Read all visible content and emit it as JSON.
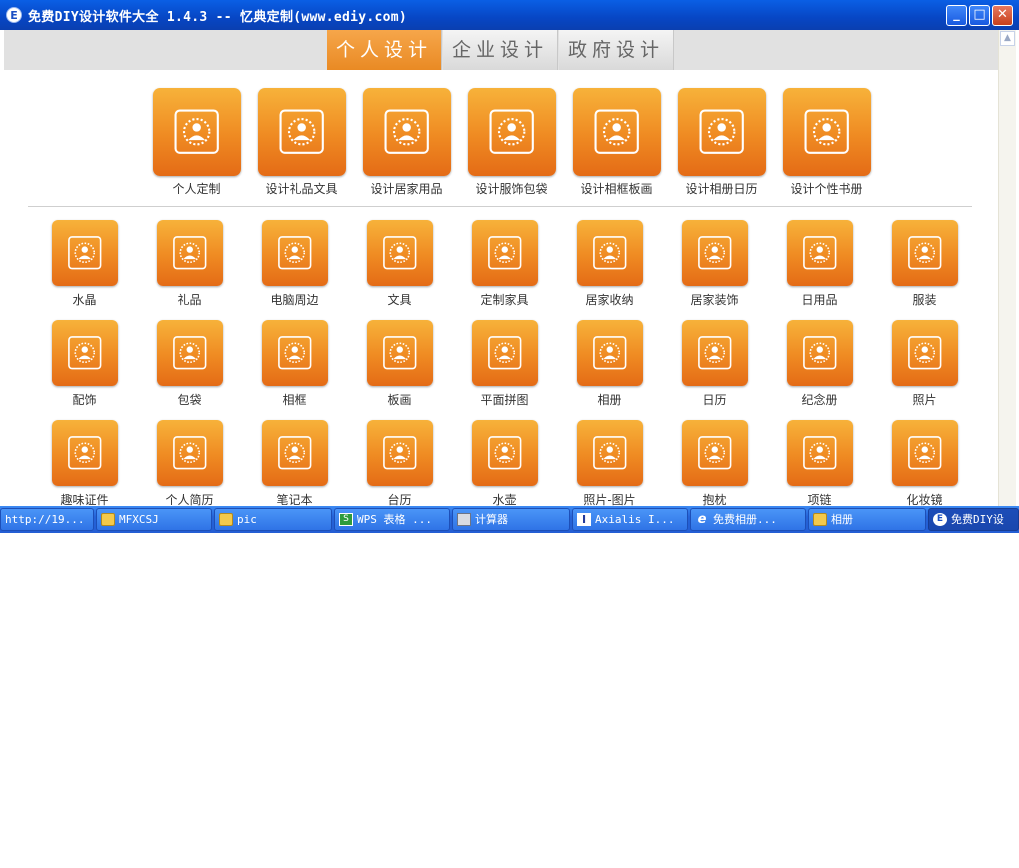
{
  "window": {
    "app_icon": "E",
    "title": "免费DIY设计软件大全 1.4.3 -- 忆典定制(www.ediy.com)",
    "buttons": {
      "minimize": "_",
      "maximize": "□",
      "close": "✕"
    }
  },
  "tabs": [
    {
      "label": "个人设计",
      "active": true
    },
    {
      "label": "企业设计",
      "active": false
    },
    {
      "label": "政府设计",
      "active": false
    }
  ],
  "scrollbar": {
    "up_arrow": "▲"
  },
  "featured": [
    {
      "label": "个人定制",
      "icon": "personal-custom-icon"
    },
    {
      "label": "设计礼品文具",
      "icon": "mug-icon"
    },
    {
      "label": "设计居家用品",
      "icon": "storage-box-icon"
    },
    {
      "label": "设计服饰包袋",
      "icon": "apparel-bag-icon"
    },
    {
      "label": "设计相框板画",
      "icon": "photo-frame-icon"
    },
    {
      "label": "设计相册日历",
      "icon": "calendar-icon"
    },
    {
      "label": "设计个性书册",
      "icon": "books-icon"
    }
  ],
  "categories": [
    {
      "label": "水晶",
      "icon": "crystal-icon"
    },
    {
      "label": "礼品",
      "icon": "keychain-icon"
    },
    {
      "label": "电脑周边",
      "icon": "laptop-table-icon"
    },
    {
      "label": "文具",
      "icon": "pencil-case-icon"
    },
    {
      "label": "定制家具",
      "icon": "stool-icon"
    },
    {
      "label": "居家收纳",
      "icon": "trash-bin-icon"
    },
    {
      "label": "居家装饰",
      "icon": "wall-clock-icon"
    },
    {
      "label": "日用品",
      "icon": "cups-icon"
    },
    {
      "label": "服装",
      "icon": "tshirt-icon"
    },
    {
      "label": "配饰",
      "icon": "cap-icon"
    },
    {
      "label": "包袋",
      "icon": "backpack-icon"
    },
    {
      "label": "相框",
      "icon": "frame-stand-icon"
    },
    {
      "label": "板画",
      "icon": "round-mirror-icon"
    },
    {
      "label": "平面拼图",
      "icon": "puzzle-icon"
    },
    {
      "label": "相册",
      "icon": "photo-album-icon"
    },
    {
      "label": "日历",
      "icon": "desk-calendar-icon"
    },
    {
      "label": "纪念册",
      "icon": "memorial-book-icon"
    },
    {
      "label": "照片",
      "icon": "photo-print-icon"
    },
    {
      "label": "趣味证件",
      "icon": "certificate-icon"
    },
    {
      "label": "个人简历",
      "icon": "resume-icon"
    },
    {
      "label": "笔记本",
      "icon": "notebook-icon"
    },
    {
      "label": "台历",
      "icon": "table-calendar-icon"
    },
    {
      "label": "水壶",
      "icon": "bottle-icon"
    },
    {
      "label": "照片-图片",
      "icon": "picture-icon"
    },
    {
      "label": "抱枕",
      "icon": "pillow-icon"
    },
    {
      "label": "项链",
      "icon": "necklace-icon"
    },
    {
      "label": "化妆镜",
      "icon": "compact-mirror-icon"
    }
  ],
  "taskbar": [
    {
      "label": "http://19...",
      "icon": "none"
    },
    {
      "label": "MFXCSJ",
      "icon": "folder-icon"
    },
    {
      "label": "pic",
      "icon": "folder-icon"
    },
    {
      "label": "WPS 表格 ...",
      "icon": "wps-icon"
    },
    {
      "label": "计算器",
      "icon": "calculator-icon"
    },
    {
      "label": "Axialis I...",
      "icon": "axialis-icon"
    },
    {
      "label": "免费相册...",
      "icon": "ie-icon"
    },
    {
      "label": "相册",
      "icon": "folder-icon"
    },
    {
      "label": "免费DIY设",
      "icon": "app-icon",
      "active": true
    }
  ],
  "colors": {
    "accent": "#ef8a22",
    "titlebar": "#0746c4",
    "taskbar": "#245ed4"
  }
}
